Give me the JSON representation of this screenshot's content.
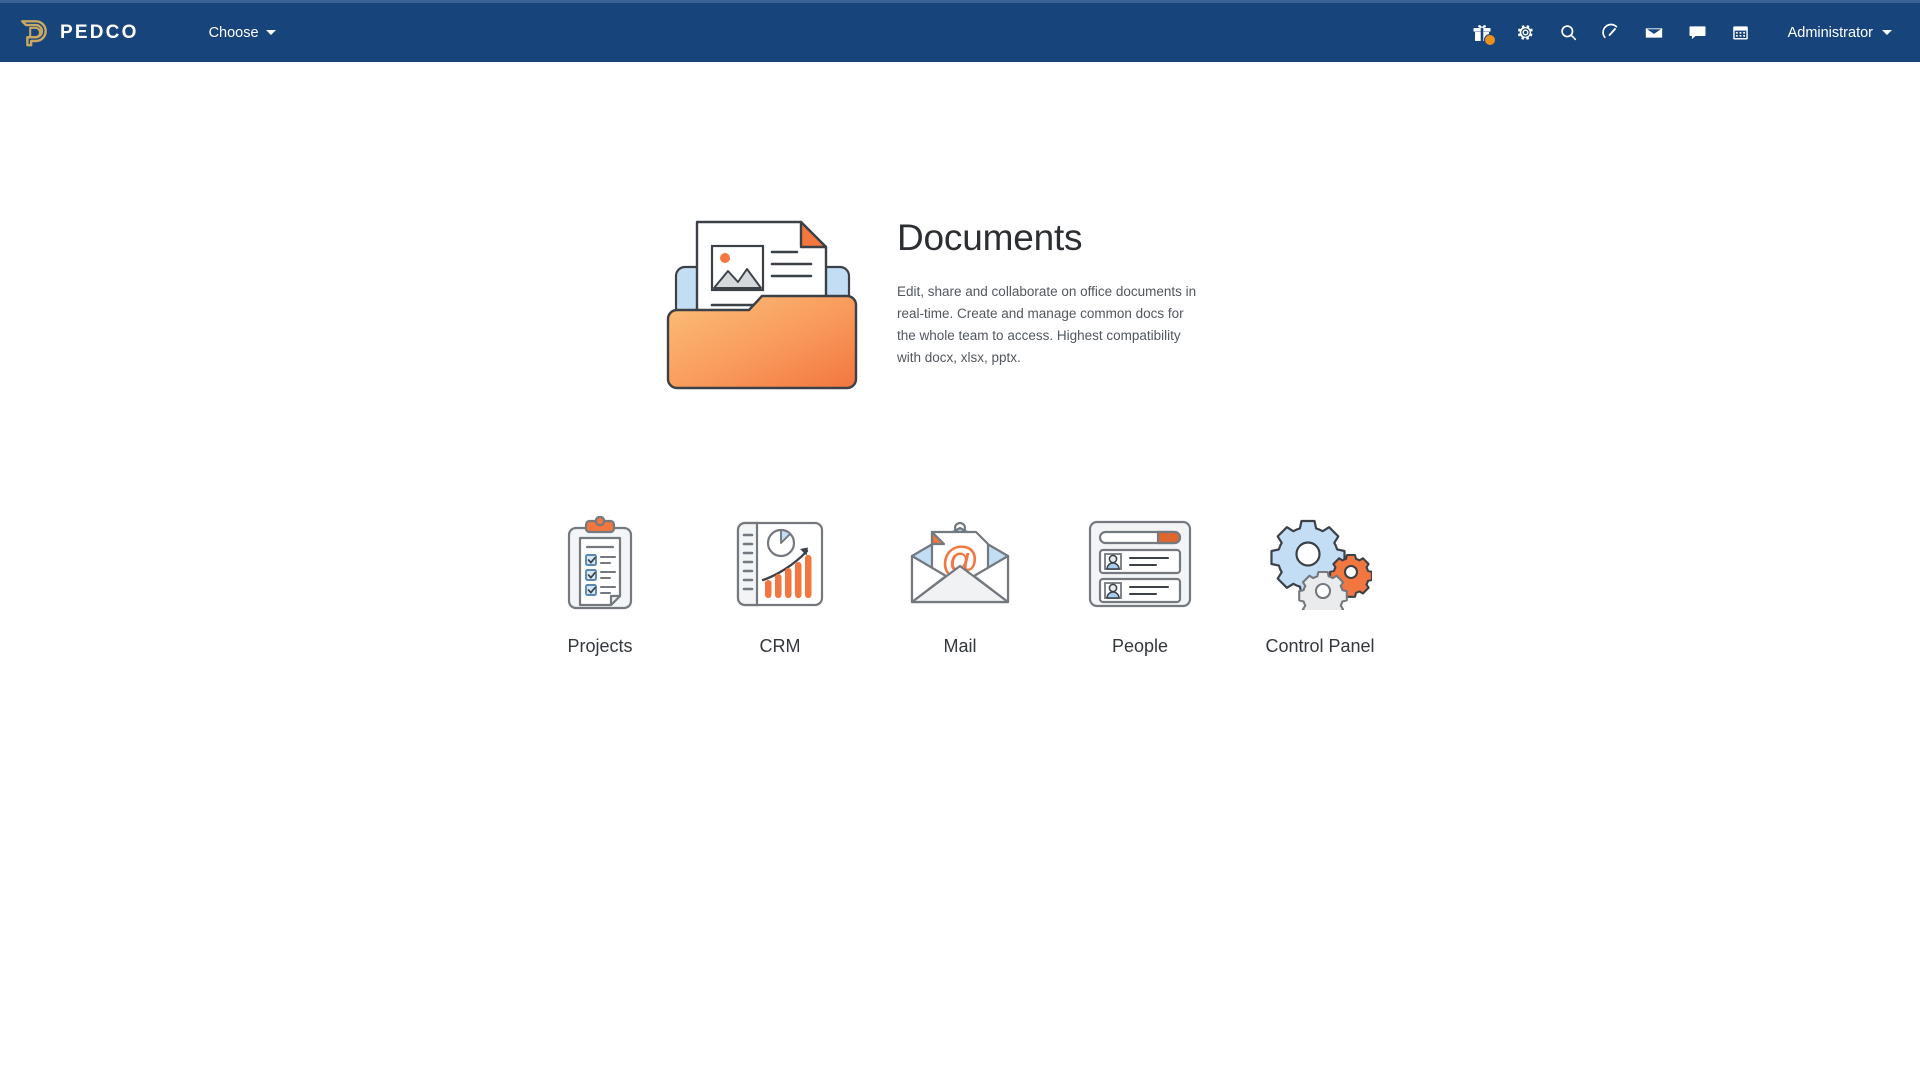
{
  "navbar": {
    "brand": {
      "name": "PEDCO",
      "logo_icon": "pedco-d-logo-icon"
    },
    "choose_label": "Choose",
    "user_label": "Administrator",
    "icons": [
      {
        "name": "gift-icon",
        "label": "Gift",
        "badge": true
      },
      {
        "name": "gear-icon",
        "label": "Settings",
        "badge": false
      },
      {
        "name": "search-icon",
        "label": "Search",
        "badge": false
      },
      {
        "name": "gauge-icon",
        "label": "Performance",
        "badge": false
      },
      {
        "name": "envelope-icon",
        "label": "Mail",
        "badge": false
      },
      {
        "name": "chat-icon",
        "label": "Messages",
        "badge": false
      },
      {
        "name": "calendar-icon",
        "label": "Calendar",
        "badge": false
      }
    ]
  },
  "hero": {
    "title": "Documents",
    "description": "Edit, share and collaborate on office documents in real-time. Create and manage common docs for the whole team to access. Highest compatibility with docx, xlsx, pptx.",
    "illustration": "documents-folder-illustration"
  },
  "apps": [
    {
      "label": "Projects",
      "icon": "clipboard-checklist-icon"
    },
    {
      "label": "CRM",
      "icon": "report-chart-icon"
    },
    {
      "label": "Mail",
      "icon": "open-envelope-at-icon"
    },
    {
      "label": "People",
      "icon": "contact-cards-icon"
    },
    {
      "label": "Control Panel",
      "icon": "gears-icon"
    }
  ],
  "colors": {
    "navbar_bg": "#17447a",
    "top_strip": "#3b6293",
    "brand_gold": "#c9a961",
    "accent_orange": "#f0793c",
    "badge_orange": "#e8921d",
    "page_bg": "#ffffff",
    "text_dark": "#2b2f33",
    "text_muted": "#52585e"
  }
}
